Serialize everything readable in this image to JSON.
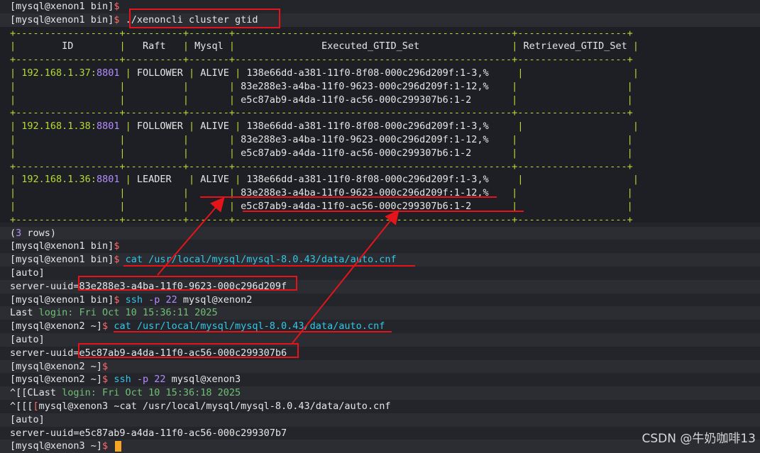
{
  "terminal": {
    "lines": [
      [
        {
          "t": "[mysql@xenon1 bin]",
          "c": "w"
        },
        {
          "t": "$",
          "c": "r"
        }
      ],
      [
        {
          "t": "[mysql@xenon1 bin]",
          "c": "w"
        },
        {
          "t": "$",
          "c": "r"
        },
        {
          "t": " ./xenoncli cluster gtid",
          "c": "w"
        }
      ],
      [
        {
          "t": "+------------------+----------+-------+------------------------------------------------+-------------------+",
          "c": "g"
        }
      ],
      [
        {
          "t": "|",
          "c": "g"
        },
        {
          "t": "        ID        ",
          "c": "w"
        },
        {
          "t": "|",
          "c": "g"
        },
        {
          "t": "   Raft   ",
          "c": "w"
        },
        {
          "t": "|",
          "c": "g"
        },
        {
          "t": " Mysql ",
          "c": "w"
        },
        {
          "t": "|",
          "c": "g"
        },
        {
          "t": "               Executed_GTID_Set               ",
          "c": "w"
        },
        {
          "t": " |",
          "c": "g"
        },
        {
          "t": " Retrieved_GTID_Set ",
          "c": "w"
        },
        {
          "t": "|",
          "c": "g"
        }
      ],
      [
        {
          "t": "+------------------+----------+-------+------------------------------------------------+-------------------+",
          "c": "g"
        }
      ],
      [
        {
          "t": "| ",
          "c": "g"
        },
        {
          "t": "192.168.1.37:",
          "c": "g"
        },
        {
          "t": "8801",
          "c": "p"
        },
        {
          "t": " ",
          "c": "w"
        },
        {
          "t": "|",
          "c": "g"
        },
        {
          "t": " FOLLOWER ",
          "c": "w"
        },
        {
          "t": "|",
          "c": "g"
        },
        {
          "t": " ALIVE ",
          "c": "w"
        },
        {
          "t": "|",
          "c": "g"
        },
        {
          "t": " 138e66dd-a381-11f0-8f08-000c296d209f:1-3,%",
          "c": "w"
        },
        {
          "t": "     |",
          "c": "g"
        },
        {
          "t": "                   ",
          "c": "w"
        },
        {
          "t": "|",
          "c": "g"
        }
      ],
      [
        {
          "t": "|                  |          |       |",
          "c": "g"
        },
        {
          "t": " 83e288e3-a4ba-11f0-9623-000c296d209f:1-12,%",
          "c": "w"
        },
        {
          "t": "    |                   |",
          "c": "g"
        }
      ],
      [
        {
          "t": "|                  |          |       |",
          "c": "g"
        },
        {
          "t": " e5c87ab9-a4da-11f0-ac56-000c299307b6:1-2",
          "c": "w"
        },
        {
          "t": "       |                   |",
          "c": "g"
        }
      ],
      [
        {
          "t": "+------------------+----------+-------+------------------------------------------------+-------------------+",
          "c": "g"
        }
      ],
      [
        {
          "t": "| ",
          "c": "g"
        },
        {
          "t": "192.168.1.38:",
          "c": "g"
        },
        {
          "t": "8801",
          "c": "p"
        },
        {
          "t": " ",
          "c": "w"
        },
        {
          "t": "|",
          "c": "g"
        },
        {
          "t": " FOLLOWER ",
          "c": "w"
        },
        {
          "t": "|",
          "c": "g"
        },
        {
          "t": " ALIVE ",
          "c": "w"
        },
        {
          "t": "|",
          "c": "g"
        },
        {
          "t": " 138e66dd-a381-11f0-8f08-000c296d209f:1-3,%",
          "c": "w"
        },
        {
          "t": "     |",
          "c": "g"
        },
        {
          "t": "                   ",
          "c": "w"
        },
        {
          "t": "|",
          "c": "g"
        }
      ],
      [
        {
          "t": "|                  |          |       |",
          "c": "g"
        },
        {
          "t": " 83e288e3-a4ba-11f0-9623-000c296d209f:1-12,%",
          "c": "w"
        },
        {
          "t": "    |                   |",
          "c": "g"
        }
      ],
      [
        {
          "t": "|                  |          |       |",
          "c": "g"
        },
        {
          "t": " e5c87ab9-a4da-11f0-ac56-000c299307b6:1-2",
          "c": "w"
        },
        {
          "t": "       |                   |",
          "c": "g"
        }
      ],
      [
        {
          "t": "+------------------+----------+-------+------------------------------------------------+-------------------+",
          "c": "g"
        }
      ],
      [
        {
          "t": "| ",
          "c": "g"
        },
        {
          "t": "192.168.1.36:",
          "c": "g"
        },
        {
          "t": "8801",
          "c": "p"
        },
        {
          "t": " ",
          "c": "w"
        },
        {
          "t": "|",
          "c": "g"
        },
        {
          "t": " LEADER   ",
          "c": "w"
        },
        {
          "t": "|",
          "c": "g"
        },
        {
          "t": " ALIVE ",
          "c": "w"
        },
        {
          "t": "|",
          "c": "g"
        },
        {
          "t": " 138e66dd-a381-11f0-8f08-000c296d209f:1-3,%",
          "c": "w"
        },
        {
          "t": "     |",
          "c": "g"
        },
        {
          "t": "                   ",
          "c": "w"
        },
        {
          "t": "|",
          "c": "g"
        }
      ],
      [
        {
          "t": "|                  |          |       |",
          "c": "g"
        },
        {
          "t": " 83e288e3-a4ba-11f0-9623-000c296d209f:1-12,%",
          "c": "w"
        },
        {
          "t": "    |                   |",
          "c": "g"
        }
      ],
      [
        {
          "t": "|                  |          |       |",
          "c": "g"
        },
        {
          "t": " e5c87ab9-a4da-11f0-ac56-000c299307b6:1-2",
          "c": "w"
        },
        {
          "t": "       |                   |",
          "c": "g"
        }
      ],
      [
        {
          "t": "+------------------+----------+-------+------------------------------------------------+-------------------+",
          "c": "g"
        }
      ],
      [
        {
          "t": "(",
          "c": "w"
        },
        {
          "t": "3",
          "c": "p"
        },
        {
          "t": " rows)",
          "c": "w"
        }
      ],
      [
        {
          "t": "[mysql@xenon1 bin]",
          "c": "w"
        },
        {
          "t": "$",
          "c": "r"
        }
      ],
      [
        {
          "t": "[mysql@xenon1 bin]",
          "c": "w"
        },
        {
          "t": "$",
          "c": "r"
        },
        {
          "t": " cat ",
          "c": "c"
        },
        {
          "t": "/usr/local/mysql/mysql-8.0.43/data/auto.cnf",
          "c": "c"
        }
      ],
      [
        {
          "t": "[auto]",
          "c": "w"
        }
      ],
      [
        {
          "t": "server-uuid=",
          "c": "w"
        },
        {
          "t": "83e288e3-a4ba-11f0-9623-000c296d209f",
          "c": "w"
        }
      ],
      [
        {
          "t": "[mysql@xenon1 bin]",
          "c": "w"
        },
        {
          "t": "$",
          "c": "r"
        },
        {
          "t": " ssh ",
          "c": "c"
        },
        {
          "t": "-p",
          "c": "p"
        },
        {
          "t": " 22 ",
          "c": "p"
        },
        {
          "t": "mysql@xenon2",
          "c": "w"
        }
      ],
      [
        {
          "t": "Last ",
          "c": "w"
        },
        {
          "t": "login: Fri Oct 10 15:36:11 2025",
          "c": "h"
        }
      ],
      [
        {
          "t": "[mysql@xenon2 ~]",
          "c": "w"
        },
        {
          "t": "$",
          "c": "r"
        },
        {
          "t": " cat ",
          "c": "c"
        },
        {
          "t": "/usr/local/mysql/mysql-8.0.43/data/auto.cnf",
          "c": "c"
        }
      ],
      [
        {
          "t": "[auto]",
          "c": "w"
        }
      ],
      [
        {
          "t": "server-uuid=",
          "c": "w"
        },
        {
          "t": "e5c87ab9-a4da-11f0-ac56-000c299307b6",
          "c": "w"
        }
      ],
      [
        {
          "t": "[mysql@xenon2 ~]",
          "c": "w"
        },
        {
          "t": "$",
          "c": "r"
        }
      ],
      [
        {
          "t": "[mysql@xenon2 ~]",
          "c": "w"
        },
        {
          "t": "$",
          "c": "r"
        },
        {
          "t": " ssh ",
          "c": "c"
        },
        {
          "t": "-p",
          "c": "p"
        },
        {
          "t": " 22 ",
          "c": "p"
        },
        {
          "t": "mysql@xenon3",
          "c": "w"
        }
      ],
      [
        {
          "t": "^[[CLast ",
          "c": "w"
        },
        {
          "t": "login: Fri Oct 10 15:36:18 2025",
          "c": "h"
        }
      ],
      [
        {
          "t": "^[[[",
          "c": "w"
        },
        {
          "t": "[",
          "c": "r"
        },
        {
          "t": "mysql@xenon3 ~cat /usr/local/mysql/mysql-8.0.43/data/auto.cnf",
          "c": "w"
        }
      ],
      [
        {
          "t": "[auto]",
          "c": "w"
        }
      ],
      [
        {
          "t": "server-uuid=e5c87ab9-a4da-11f0-ac56-000c299307b7",
          "c": "w"
        }
      ],
      [
        {
          "t": "[mysql@xenon3 ~]",
          "c": "w"
        },
        {
          "t": "$",
          "c": "r"
        },
        {
          "t": " ",
          "c": "w"
        }
      ]
    ]
  },
  "watermark": "CSDN @牛奶咖啡13",
  "colors": {
    "annotation": "#e5141b",
    "border": "#b7d936",
    "port": "#b58cff",
    "command": "#33c7e8",
    "cursor": "#f5a623"
  }
}
